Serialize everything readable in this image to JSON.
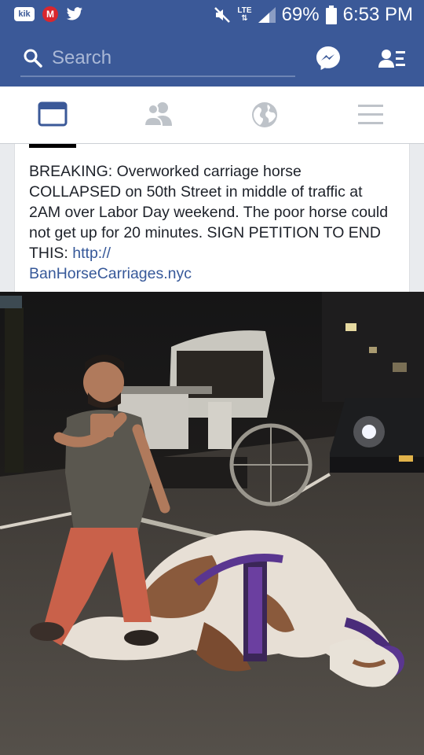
{
  "status_bar": {
    "kik_label": "kik",
    "mega_label": "M",
    "network": "LTE",
    "battery_percent": "69%",
    "time": "6:53 PM"
  },
  "search": {
    "placeholder": "Search"
  },
  "nav": {
    "active_tab": "news-feed"
  },
  "post": {
    "text": "BREAKING: Overworked carriage horse COLLAPSED on 50th Street in middle of traffic at 2AM over Labor Day weekend. The poor horse could not get up for 20 minutes. SIGN PETITION TO END THIS:",
    "link_text": "http://\nBanHorseCarriages.nyc"
  },
  "colors": {
    "facebook_blue": "#3b5998",
    "link_blue": "#365899"
  }
}
